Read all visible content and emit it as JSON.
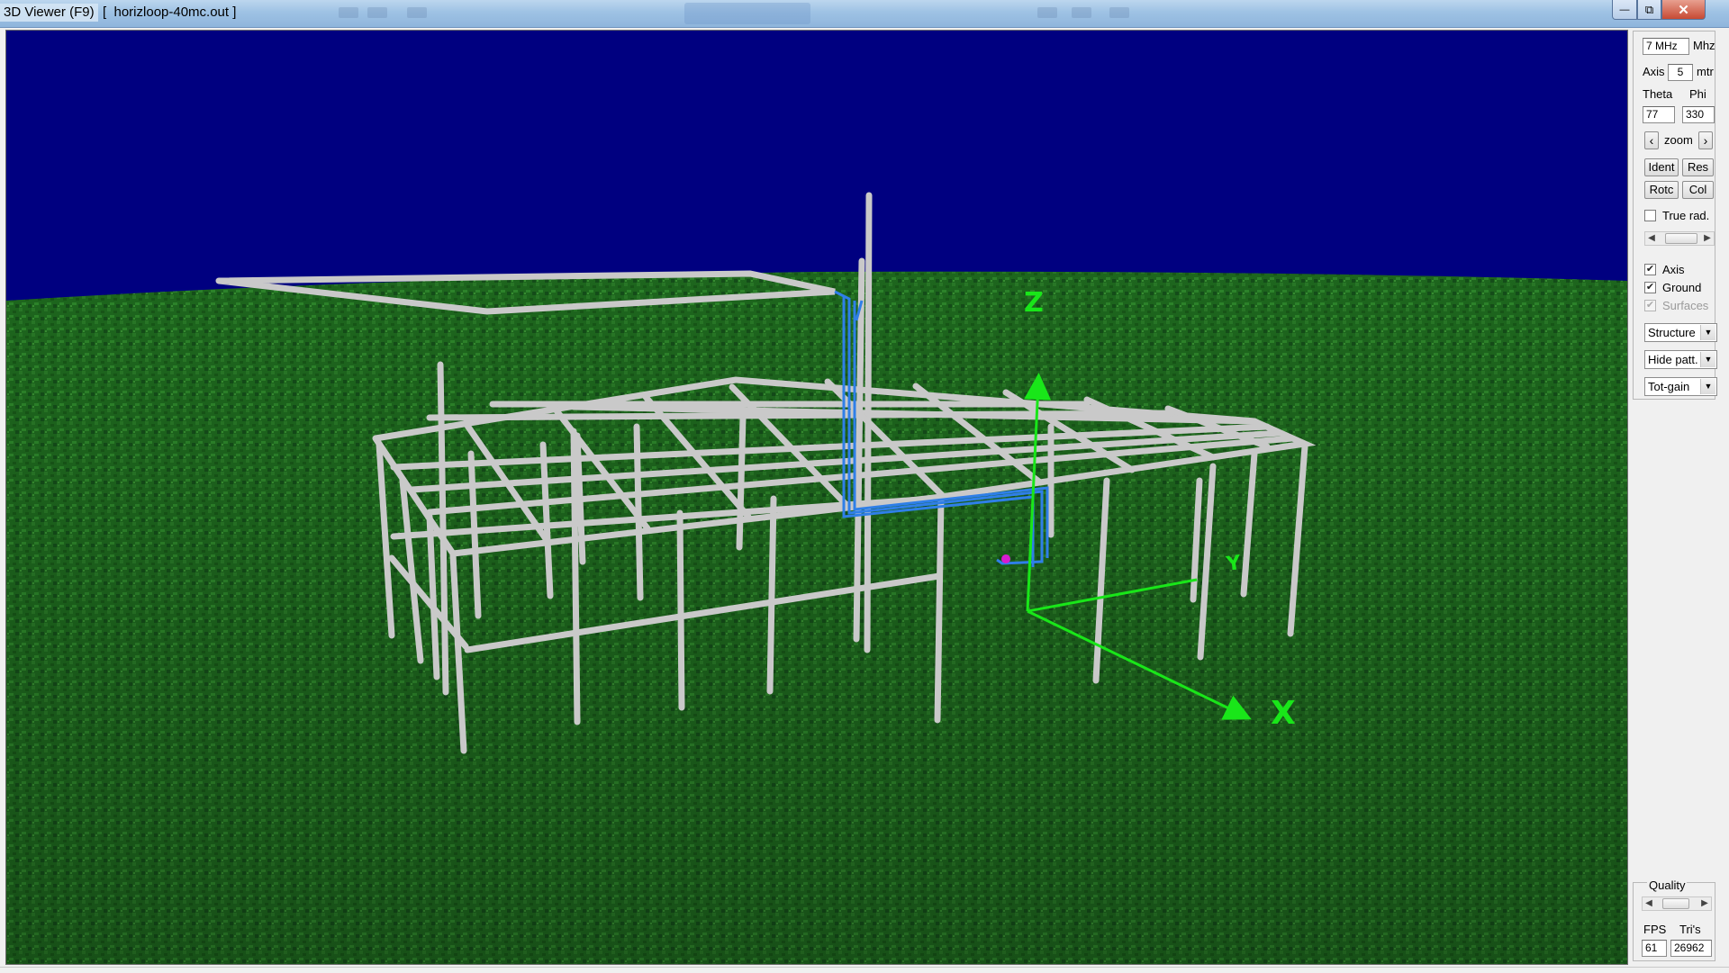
{
  "window": {
    "title": "3D Viewer (F9)",
    "file": "[  horizloop-40mc.out ]",
    "min_glyph": "—",
    "max_glyph": "⧉",
    "close_glyph": "✕"
  },
  "viewport": {
    "sky_color": "#000080",
    "ground_color": "#1f6b1f",
    "structure_color": "#c8c8c8",
    "antenna_color": "#2f7fe8",
    "axis_color": "#19e619",
    "axis_labels": {
      "x": "X",
      "y": "Y",
      "z": "Z"
    }
  },
  "panel": {
    "freq": {
      "value": "7 MHz",
      "unit": "Mhz"
    },
    "axis": {
      "label": "Axis",
      "value": "5",
      "unit": "mtr"
    },
    "theta": {
      "label": "Theta",
      "value": "77"
    },
    "phi": {
      "label": "Phi",
      "value": "330"
    },
    "zoom": {
      "label": "zoom",
      "left": "‹",
      "right": "›"
    },
    "buttons": {
      "ident": "Ident",
      "res": "Res",
      "rotc": "Rotc",
      "col": "Col"
    },
    "true_rad": {
      "label": "True rad.",
      "checked": false
    },
    "checks": {
      "axis": {
        "label": "Axis",
        "checked": true
      },
      "ground": {
        "label": "Ground",
        "checked": true
      },
      "surfaces": {
        "label": "Surfaces",
        "checked": true,
        "disabled": true
      }
    },
    "selects": {
      "view": "Structure",
      "pattern": "Hide patt.",
      "gain": "Tot-gain"
    },
    "quality": {
      "label": "Quality"
    },
    "fps": {
      "label": "FPS",
      "value": "61"
    },
    "tris": {
      "label": "Tri's",
      "value": "26962"
    }
  }
}
